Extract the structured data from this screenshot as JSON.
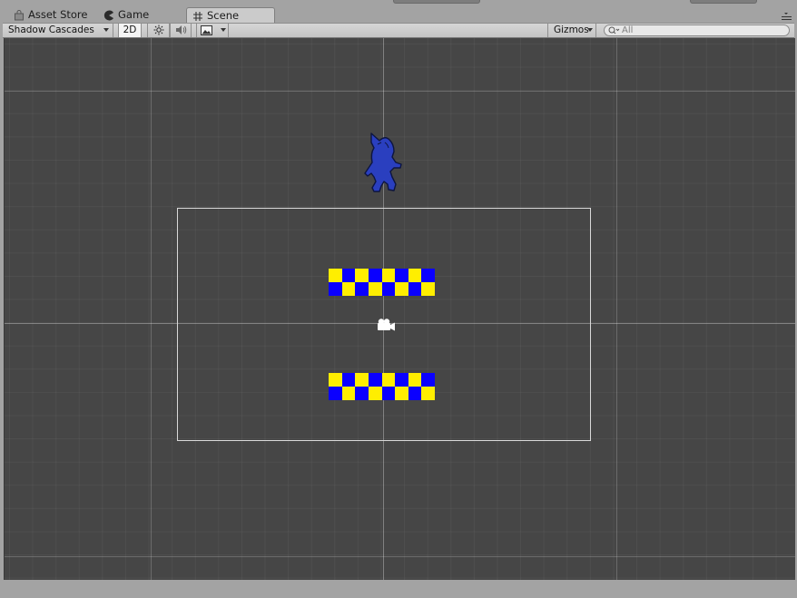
{
  "tabs": [
    {
      "label": "Asset Store",
      "icon": "bag-icon",
      "active": false
    },
    {
      "label": "Game",
      "icon": "pacman-icon",
      "active": false
    },
    {
      "label": "Scene",
      "icon": "hash-icon",
      "active": true
    }
  ],
  "toolbar": {
    "draw_mode": "Shadow Cascades",
    "mode_2d": "2D",
    "lighting_icon": "sun-icon",
    "audio_icon": "speaker-icon",
    "effects_icon": "image-icon",
    "gizmos": "Gizmos",
    "search_placeholder": "All"
  },
  "scene": {
    "sprite_icon": "character-sprite",
    "camera_icon": "camera-gizmo-icon",
    "colors": {
      "checker_yellow": "#ffee00",
      "checker_blue": "#0a00ff",
      "sprite": "#2a3fbf",
      "background": "#464646"
    }
  }
}
